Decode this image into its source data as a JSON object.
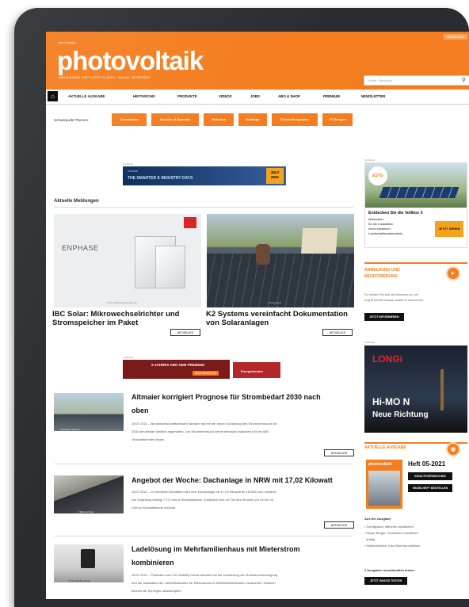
{
  "header": {
    "pretitle": "von Gordon",
    "logo": "photovoltaik",
    "tagline": "DAS MAGAZIN FÜR PROFIS: PLANEN · BAUEN · BETREIBEN",
    "login": "ANMELDEN",
    "search_placeholder": "Suche / Webcode"
  },
  "nav": {
    "home_icon": "home-icon",
    "items": [
      "AKTUELLE AUSGABE",
      "HEFTARCHIV",
      "PRODUKTE",
      "VIDEOS",
      "JOBS",
      "ABO & SHOP",
      "PREMIUM",
      "NEWSLETTER"
    ]
  },
  "topics": {
    "label": "Schwerpunkt-Themen:",
    "buttons": [
      "Coronavirus",
      "Dossiers & Specials",
      "Webinare",
      "Kataloge",
      "Einstrahlungsatlas",
      "PV Dungen"
    ]
  },
  "top_banner": {
    "ad_label": "ANZEIGE",
    "logo": "innovate",
    "title": "THE SMARTER E INDUSTRY DAYS",
    "date": "JULY 2021"
  },
  "section_title": "Aktuelle Meldungen",
  "articles_top": [
    {
      "image_text": "ENPHASE",
      "caption": "© IBC Solar/Enphase Energy",
      "headline_line1": "IBC Solar: Mikrowechselrichter und",
      "headline_line2": "Stromspeicher im Paket",
      "tag": "AKTUELLES"
    },
    {
      "caption": "K2 Systems",
      "headline_line1": "K2 Systems vereinfacht Dokumentation",
      "headline_line2": "von Solaranlagen",
      "tag": "AKTUELLES"
    }
  ],
  "mid_banner": {
    "ad_label": "ANZEIGE",
    "text": "2-JAHRES ABO GEB PREMIUM",
    "button": "JETZT BESTELLEN",
    "right": "Energieberater"
  },
  "articles_list": [
    {
      "caption": "© Fotolia / Stocker",
      "headline_line1": "Altmaier korrigiert Prognose für Strombedarf 2030 nach",
      "headline_line2": "oben",
      "teaser_line1": "18.07.2021 – Bundeswirtschaftsminister Altmaier hat mit der neuen Schätzung des Stromverbrauchs für",
      "teaser_line2": "2030 den Bedarf deutlich angehoben. Der Stromverbrauch werde demnach zwischen 645 bis 665",
      "teaser_line3": "Terawattstunden liegen.",
      "tag": "AKTUELLES"
    },
    {
      "caption": "© Effe Hot Sun",
      "headline_line1": "Angebot der Woche: Dachanlage in NRW mit 17,02 Kilowatt",
      "teaser_line1": "18.07.2021 – In Nordrhein-Westfalen wird eine Dachanlage mit 17,02 Kilowatt für 18.000 Euro verkauft.",
      "teaser_line2": "Die Vergütung beträgt 7,72 Cent je Kilowattstunde. Zusätzlich wird ein Teil des Stromes vor Ort für 25",
      "teaser_line3": "Cent je Kilowattstunde verkauft.",
      "tag": "AKTUELLES"
    },
    {
      "caption": "© The Mobility House",
      "headline_line1": "Ladelösung im Mehrfamilienhaus mit Mieterstrom",
      "headline_line2": "kombinieren",
      "teaser_line1": "18.07.2021 – Polarstern und The Mobility House arbeiten bei der Umsetzung von Solarstromversorgung",
      "teaser_line2": "und der Installation der Ladeinfrastruktur für Elektroautos in Mehrfamilienhäusern zusammen. Dadurch",
      "teaser_line3": "können die Synergien ausschöpfen."
    }
  ],
  "sidebar": {
    "ad1": {
      "ad_label": "ANZEIGE",
      "brand": "ESTG",
      "text_line1": "Entdecken Sie die Vollbox 3",
      "text_line2": "Materialien",
      "text_line3": "für die Installation",
      "text_line4": "eines einzelnen",
      "text_line5": "Landschaftssolarmoduls",
      "badge": "JETZT SEHEN"
    },
    "register": {
      "title_line1": "ANMELDUNG UND",
      "title_line2": "REGISTRIERUNG",
      "icon": "speaker-icon",
      "text_line1": "So melden Sie sich als Abonnent an, um",
      "text_line2": "Zugriff auf alle Zusatz-Inhalte zu bekommen.",
      "button": "JETZT INFORMIEREN"
    },
    "ad2": {
      "ad_label": "ANZEIGE",
      "brand": "LONGi",
      "product": "Hi-MO N",
      "slogan": "Neue Richtung"
    },
    "issue": {
      "title": "AKTUELLE AUSGABE",
      "icon": "target-icon",
      "cover": "photovoltaik",
      "heft": "Heft 05-2021",
      "button1": "INHALTSVERZEICHNIS",
      "button2": "EINZELHEFT BESTELLEN",
      "list_title": "Aus der Ausgabe:",
      "items": [
        "Schrägdach: Mitnehm-Installieren",
        "Meyer Burger: Schweizer investieren",
        "kräftig",
        "Marktrückblick: Das Dilemma auflösen"
      ],
      "trial_text": "2 Ausgaben unverbindlich testen:",
      "trial_button": "JETZT GRATIS TESTEN"
    }
  },
  "colors": {
    "brand": "#f47d1f",
    "frame": "#2a2c30"
  }
}
